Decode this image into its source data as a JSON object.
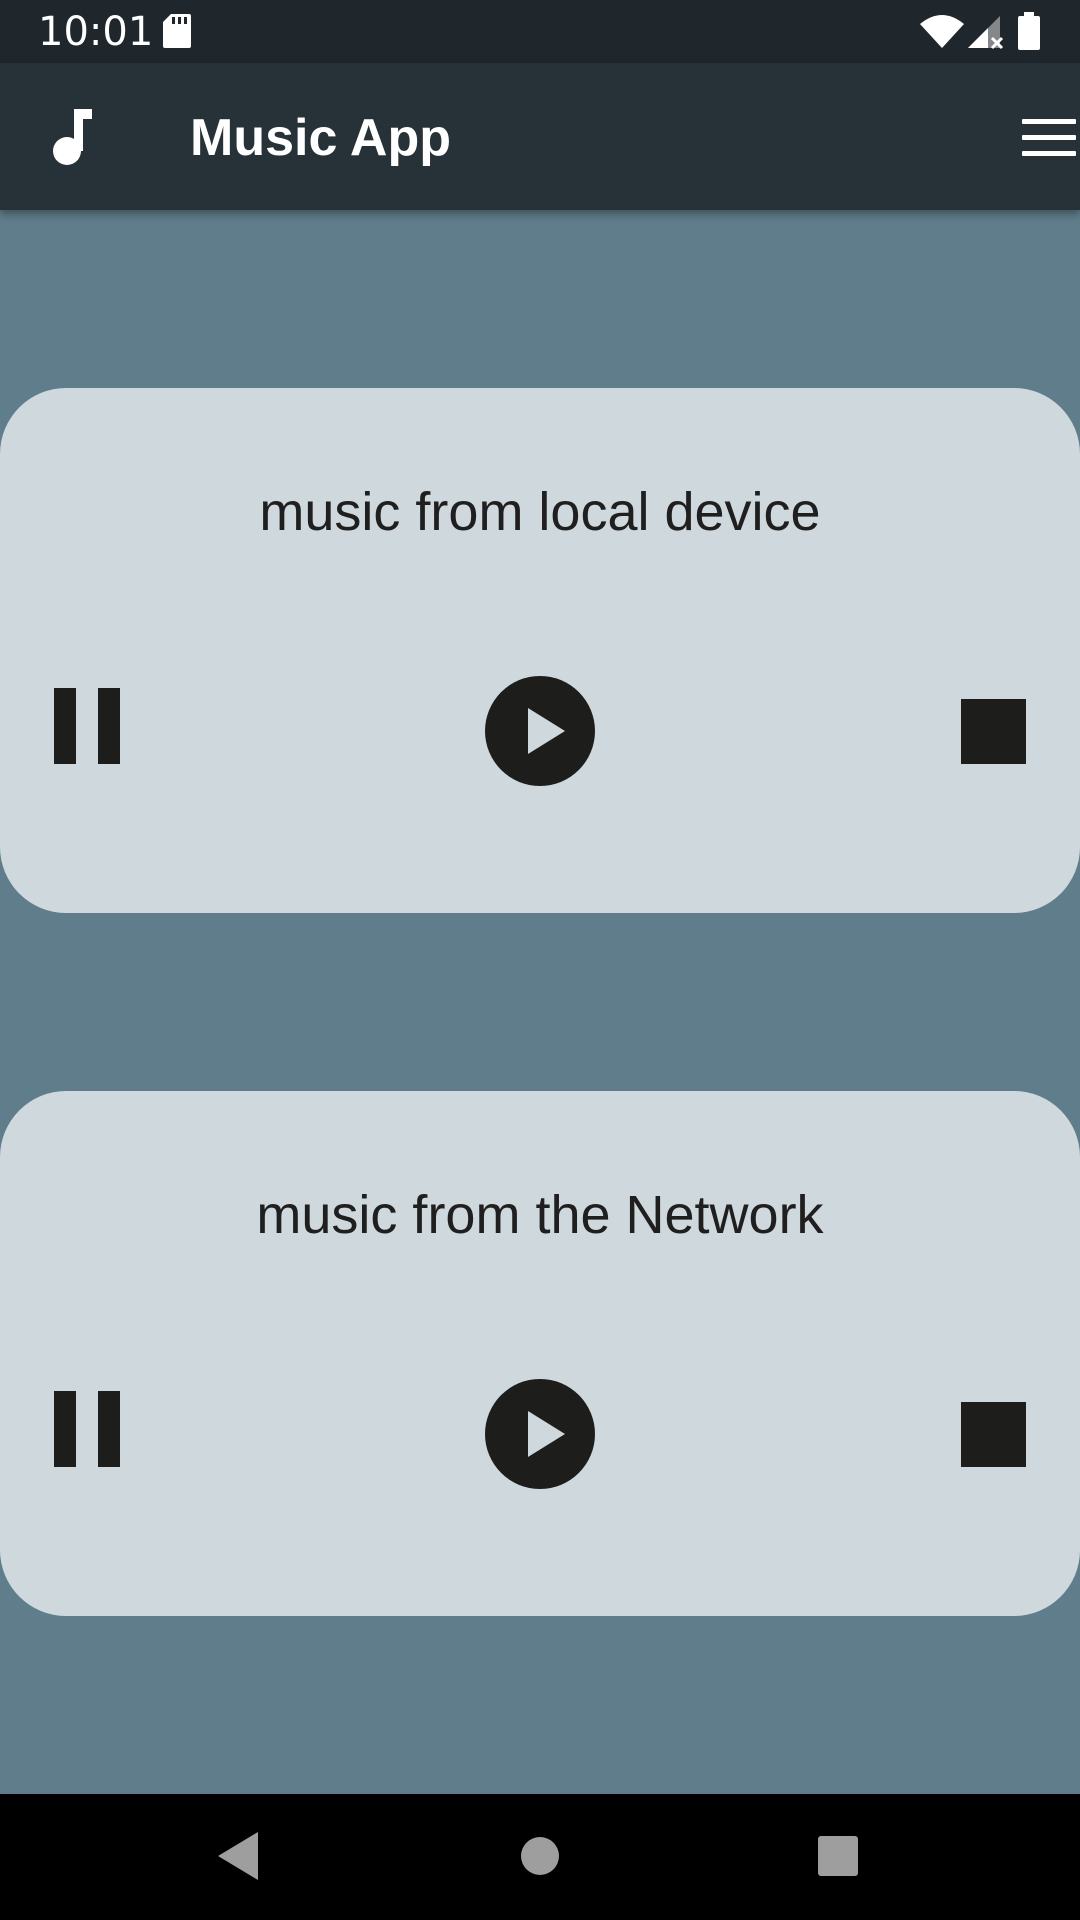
{
  "status_bar": {
    "time": "10:01",
    "icons": [
      "sd-card-icon",
      "wifi-icon",
      "signal-icon",
      "battery-icon"
    ]
  },
  "app_bar": {
    "icon": "music-note-icon",
    "title": "Music App",
    "menu_icon": "menu-icon"
  },
  "players": [
    {
      "title": "music from local device",
      "controls": [
        "pause-icon",
        "play-icon",
        "stop-icon"
      ]
    },
    {
      "title": "music from the Network",
      "controls": [
        "pause-icon",
        "play-icon",
        "stop-icon"
      ]
    }
  ],
  "nav_bar": {
    "buttons": [
      "back-icon",
      "home-icon",
      "recents-icon"
    ]
  },
  "colors": {
    "status_bar": "#1f272d",
    "app_bar": "#263238",
    "background": "#607d8b",
    "card": "#cfd8dc",
    "control": "#1d1d1b",
    "text": "#1e1f1e"
  }
}
